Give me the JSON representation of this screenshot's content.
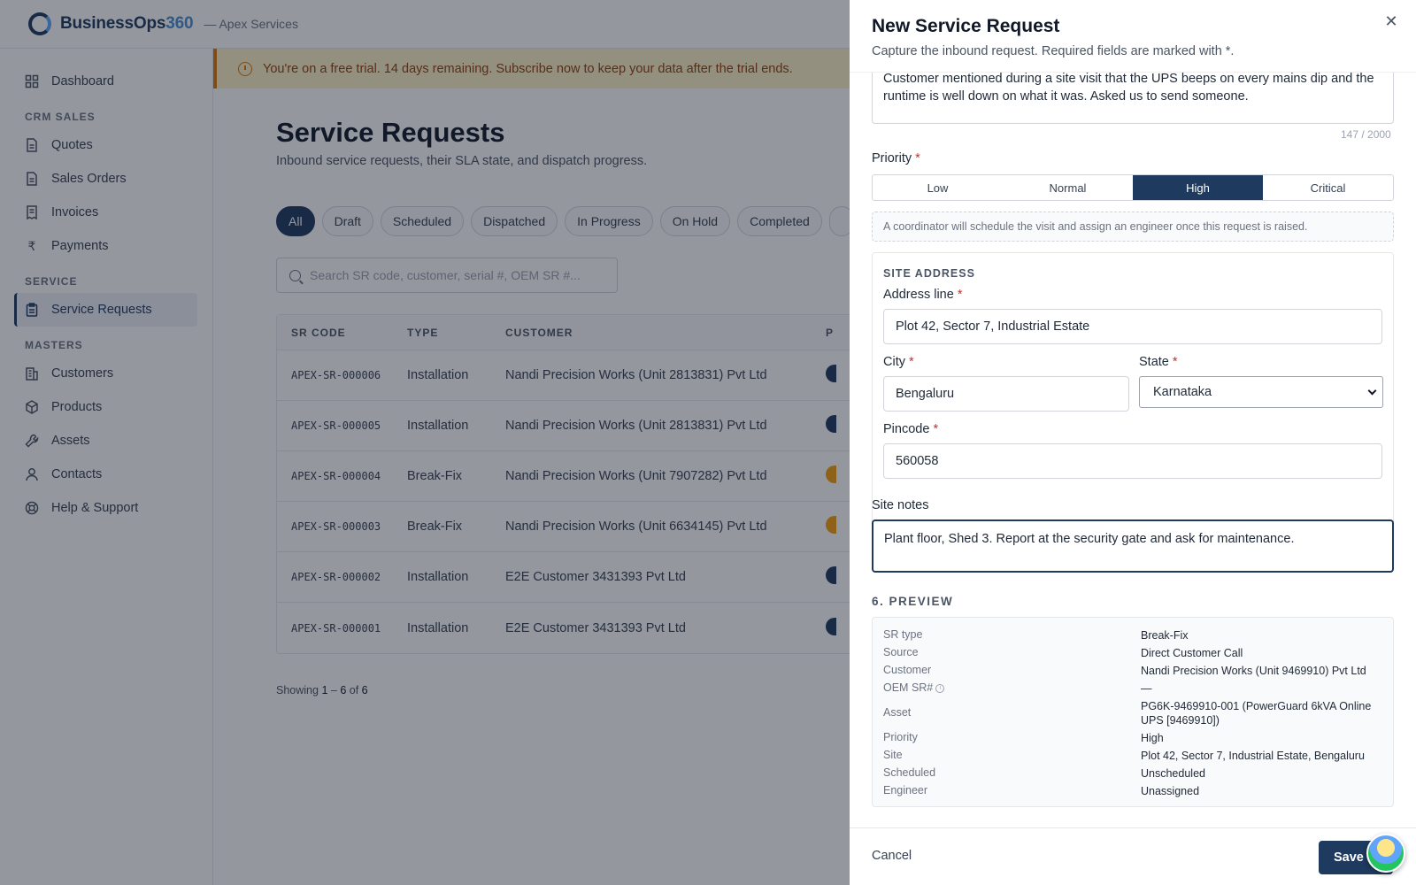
{
  "app": {
    "brand_primary": "BusinessOps",
    "brand_accent": "360",
    "org": "— Apex Services",
    "colors": {
      "brand": "#1e3a5f",
      "accent": "#4a8fd4",
      "warning": "#d97706",
      "required": "#dc2626"
    }
  },
  "sidebar": {
    "dashboard": {
      "label": "Dashboard",
      "icon": "dashboard-icon"
    },
    "crm_section": "CRM SALES",
    "crm_items": [
      {
        "label": "Quotes",
        "icon": "document-icon"
      },
      {
        "label": "Sales Orders",
        "icon": "document-icon"
      },
      {
        "label": "Invoices",
        "icon": "receipt-icon"
      },
      {
        "label": "Payments",
        "icon": "rupee-icon"
      }
    ],
    "service_section": "SERVICE",
    "service_items": [
      {
        "label": "Service Requests",
        "icon": "clipboard-icon",
        "active": true
      }
    ],
    "masters_section": "MASTERS",
    "masters_items": [
      {
        "label": "Customers",
        "icon": "building-icon"
      },
      {
        "label": "Products",
        "icon": "box-icon"
      },
      {
        "label": "Assets",
        "icon": "wrench-icon"
      },
      {
        "label": "Contacts",
        "icon": "user-icon"
      },
      {
        "label": "Help & Support",
        "icon": "lifebuoy-icon"
      }
    ]
  },
  "banner": {
    "text": "You're on a free trial. 14 days remaining. Subscribe now to keep your data after the trial ends."
  },
  "page": {
    "title": "Service Requests",
    "subtitle": "Inbound service requests, their SLA state, and dispatch progress.",
    "filters": [
      "All",
      "Draft",
      "Scheduled",
      "Dispatched",
      "In Progress",
      "On Hold",
      "Completed"
    ],
    "active_filter": "All",
    "search_placeholder": "Search SR code, customer, serial #, OEM SR #...",
    "table": {
      "headers": [
        "SR CODE",
        "TYPE",
        "CUSTOMER",
        "P"
      ],
      "rows": [
        {
          "code": "APEX-SR-000006",
          "type": "Installation",
          "customer": "Nandi Precision Works (Unit 2813831) Pvt Ltd"
        },
        {
          "code": "APEX-SR-000005",
          "type": "Installation",
          "customer": "Nandi Precision Works (Unit 2813831) Pvt Ltd"
        },
        {
          "code": "APEX-SR-000004",
          "type": "Break-Fix",
          "customer": "Nandi Precision Works (Unit 7907282) Pvt Ltd"
        },
        {
          "code": "APEX-SR-000003",
          "type": "Break-Fix",
          "customer": "Nandi Precision Works (Unit 6634145) Pvt Ltd"
        },
        {
          "code": "APEX-SR-000002",
          "type": "Installation",
          "customer": "E2E Customer 3431393 Pvt Ltd"
        },
        {
          "code": "APEX-SR-000001",
          "type": "Installation",
          "customer": "E2E Customer 3431393 Pvt Ltd"
        }
      ]
    },
    "showing": {
      "prefix": "Showing",
      "from": "1",
      "sep": "–",
      "to": "6",
      "of": "of",
      "total": "6"
    }
  },
  "drawer": {
    "title": "New Service Request",
    "subtitle": "Capture the inbound request. Required fields are marked with *.",
    "description": {
      "line1": "Customer mentioned during a site visit that the UPS beeps on every mains dip and the",
      "line2": "runtime is well down on what it was. Asked us to send someone.",
      "counter": "147 / 2000"
    },
    "priority": {
      "label": "Priority",
      "options": [
        "Low",
        "Normal",
        "High",
        "Critical"
      ],
      "selected": "High"
    },
    "hint": "A coordinator will schedule the visit and assign an engineer once this request is raised.",
    "site": {
      "section": "SITE ADDRESS",
      "address_label": "Address line",
      "address_value": "Plot 42, Sector 7, Industrial Estate",
      "city_label": "City",
      "city_value": "Bengaluru",
      "state_label": "State",
      "state_value": "Karnataka",
      "pincode_label": "Pincode",
      "pincode_value": "560058"
    },
    "site_notes": {
      "label": "Site notes",
      "value": "Plant floor, Shed 3. Report at the security gate and ask for maintenance."
    },
    "preview": {
      "heading": "6. PREVIEW",
      "rows": [
        {
          "k": "SR type",
          "v": "Break-Fix"
        },
        {
          "k": "Source",
          "v": "Direct Customer Call"
        },
        {
          "k": "Customer",
          "v": "Nandi Precision Works (Unit 9469910) Pvt Ltd"
        },
        {
          "k": "OEM SR#",
          "v": "—"
        },
        {
          "k": "Asset",
          "v": "PG6K-9469910-001 (PowerGuard 6kVA Online",
          "v2": "UPS [9469910])"
        },
        {
          "k": "Priority",
          "v": "High"
        },
        {
          "k": "Site",
          "v": "Plot 42, Sector 7, Industrial Estate, Bengaluru"
        },
        {
          "k": "Scheduled",
          "v": "Unscheduled"
        },
        {
          "k": "Engineer",
          "v": "Unassigned"
        }
      ]
    },
    "footer": {
      "cancel": "Cancel",
      "save": "Save"
    }
  }
}
